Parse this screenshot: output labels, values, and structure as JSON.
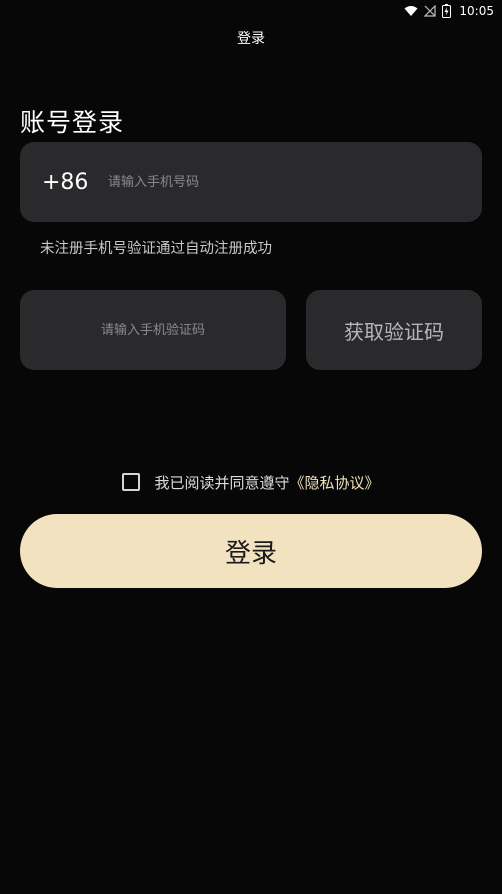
{
  "status_bar": {
    "time": "10:05",
    "icons": [
      "wifi-icon",
      "no-signal-icon",
      "battery-charging-icon"
    ]
  },
  "nav": {
    "title": "登录"
  },
  "page_title": "账号登录",
  "phone": {
    "country_code": "+86",
    "placeholder": "请输入手机号码"
  },
  "hint": "未注册手机号验证通过自动注册成功",
  "code": {
    "placeholder": "请输入手机验证码",
    "get_code_label": "获取验证码"
  },
  "agreement": {
    "text": "我已阅读并同意遵守",
    "link": "《隐私协议》",
    "checked": false
  },
  "login_button": "登录",
  "colors": {
    "background": "#070707",
    "field": "#2a2a2c",
    "accent": "#f2e2bf"
  }
}
